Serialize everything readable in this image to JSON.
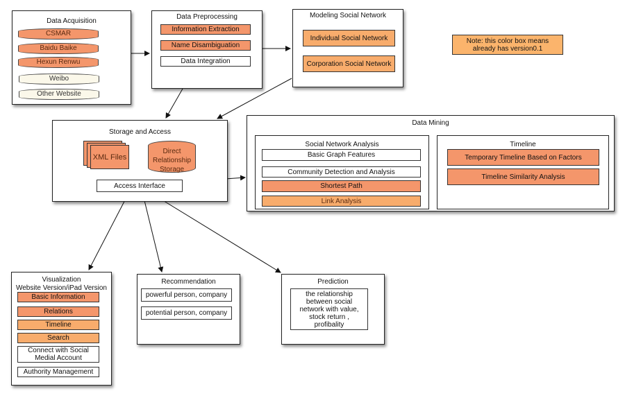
{
  "colors": {
    "implemented": "#f4966b",
    "implemented_light": "#f8ac6c",
    "note": "#fbb46c"
  },
  "acquisition": {
    "title": "Data Acquisition",
    "sources": [
      "CSMAR",
      "Baidu Baike",
      "Hexun Renwu",
      "Weibo",
      "Other Website"
    ]
  },
  "preprocessing": {
    "title": "Data Preprocessing",
    "items": [
      "Information Extraction",
      "Name Disambiguation",
      "Data Integration"
    ]
  },
  "modeling": {
    "title": "Modeling Social Network",
    "items": [
      "Individual Social Network",
      "Corporation Social Network"
    ]
  },
  "note": {
    "text": "Note: this color box means already has version0.1"
  },
  "storage": {
    "title": "Storage and Access",
    "xml": "XML Files",
    "db": "Direct Relationship Storage",
    "interface": "Access Interface"
  },
  "mining": {
    "title": "Data Mining",
    "sna": {
      "title": "Social Network Analysis",
      "items": [
        "Basic Graph Features",
        "Community Detection and Analysis",
        "Shortest Path",
        "Link Analysis"
      ]
    },
    "timeline": {
      "title": "Timeline",
      "items": [
        "Temporary Timeline Based on Factors",
        "Timeline Similarity Analysis"
      ]
    }
  },
  "visualization": {
    "title": "Visualization",
    "subtitle": "Website Version/iPad Version",
    "items": [
      "Basic Information",
      "Relations",
      "Timeline",
      "Search",
      "Connect with Social Medial Account",
      "Authority Management"
    ]
  },
  "recommendation": {
    "title": "Recommendation",
    "items": [
      "powerful person, company",
      "potential person, company"
    ]
  },
  "prediction": {
    "title": "Prediction",
    "text": "the relationship between social network with value, stock return , profibality"
  }
}
